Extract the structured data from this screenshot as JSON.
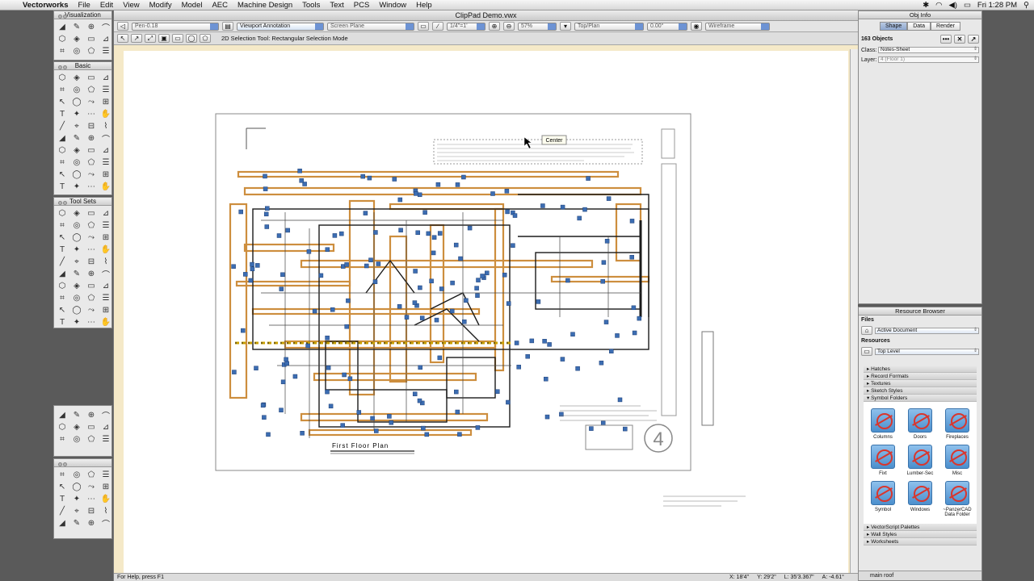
{
  "menubar": {
    "app": "Vectorworks",
    "items": [
      "File",
      "Edit",
      "View",
      "Modify",
      "Model",
      "AEC",
      "Machine Design",
      "Tools",
      "Text",
      "PCS",
      "Window",
      "Help"
    ],
    "clock": "Fri 1:28 PM"
  },
  "palettes": {
    "visualization": "Visualization",
    "basic": "Basic",
    "toolsets": "Tool Sets"
  },
  "document": {
    "title": "ClipPad Demo.vwx",
    "pen": "Pen-0.18",
    "layer": "Viewport Annotation",
    "plane": "Screen Plane",
    "scale": "1/4\"=1'",
    "zoom": "57%",
    "view": "Top/Plan",
    "angle": "0.00°",
    "render": "Wireframe",
    "mode_text": "2D Selection Tool: Rectangular Selection Mode",
    "tooltip": "Center",
    "drawing_title": "First Floor Plan",
    "sheet_number": "4",
    "status_help": "For Help, press F1",
    "coords": {
      "x": "X: 18'4\"",
      "y": "Y: 29'2\"",
      "l": "L: 35'3.367\"",
      "a": "A: -4.61°"
    }
  },
  "objinfo": {
    "title": "Obj Info",
    "tabs": [
      "Shape",
      "Data",
      "Render"
    ],
    "count": "163 Objects",
    "class_label": "Class:",
    "class_value": "Notes-Sheet",
    "layer_label": "Layer:",
    "layer_value": "4 (Floor 1)"
  },
  "resource_browser": {
    "title": "Resource Browser",
    "files_label": "Files",
    "files_value": "Active Document",
    "resources_label": "Resources",
    "resources_value": "Top Level",
    "folders": [
      "Hatches",
      "Record Formats",
      "Textures",
      "Sketch Styles",
      "Symbol Folders"
    ],
    "symbols": [
      "Columns",
      "Doors",
      "Fireplaces",
      "Fixt",
      "Lumber-Sec",
      "Misc",
      "Symbol",
      "Windows",
      "~PanzerCAD Data Folder"
    ],
    "folders_bottom": [
      "VectorScript Palettes",
      "Wall Styles",
      "Worksheets"
    ],
    "current": "main roof"
  },
  "colors": {
    "canvas_bg": "#f5e9c8",
    "accent": "#6d93d4",
    "wall_orange": "#c8822a",
    "selection_blue": "#3c6db2"
  }
}
